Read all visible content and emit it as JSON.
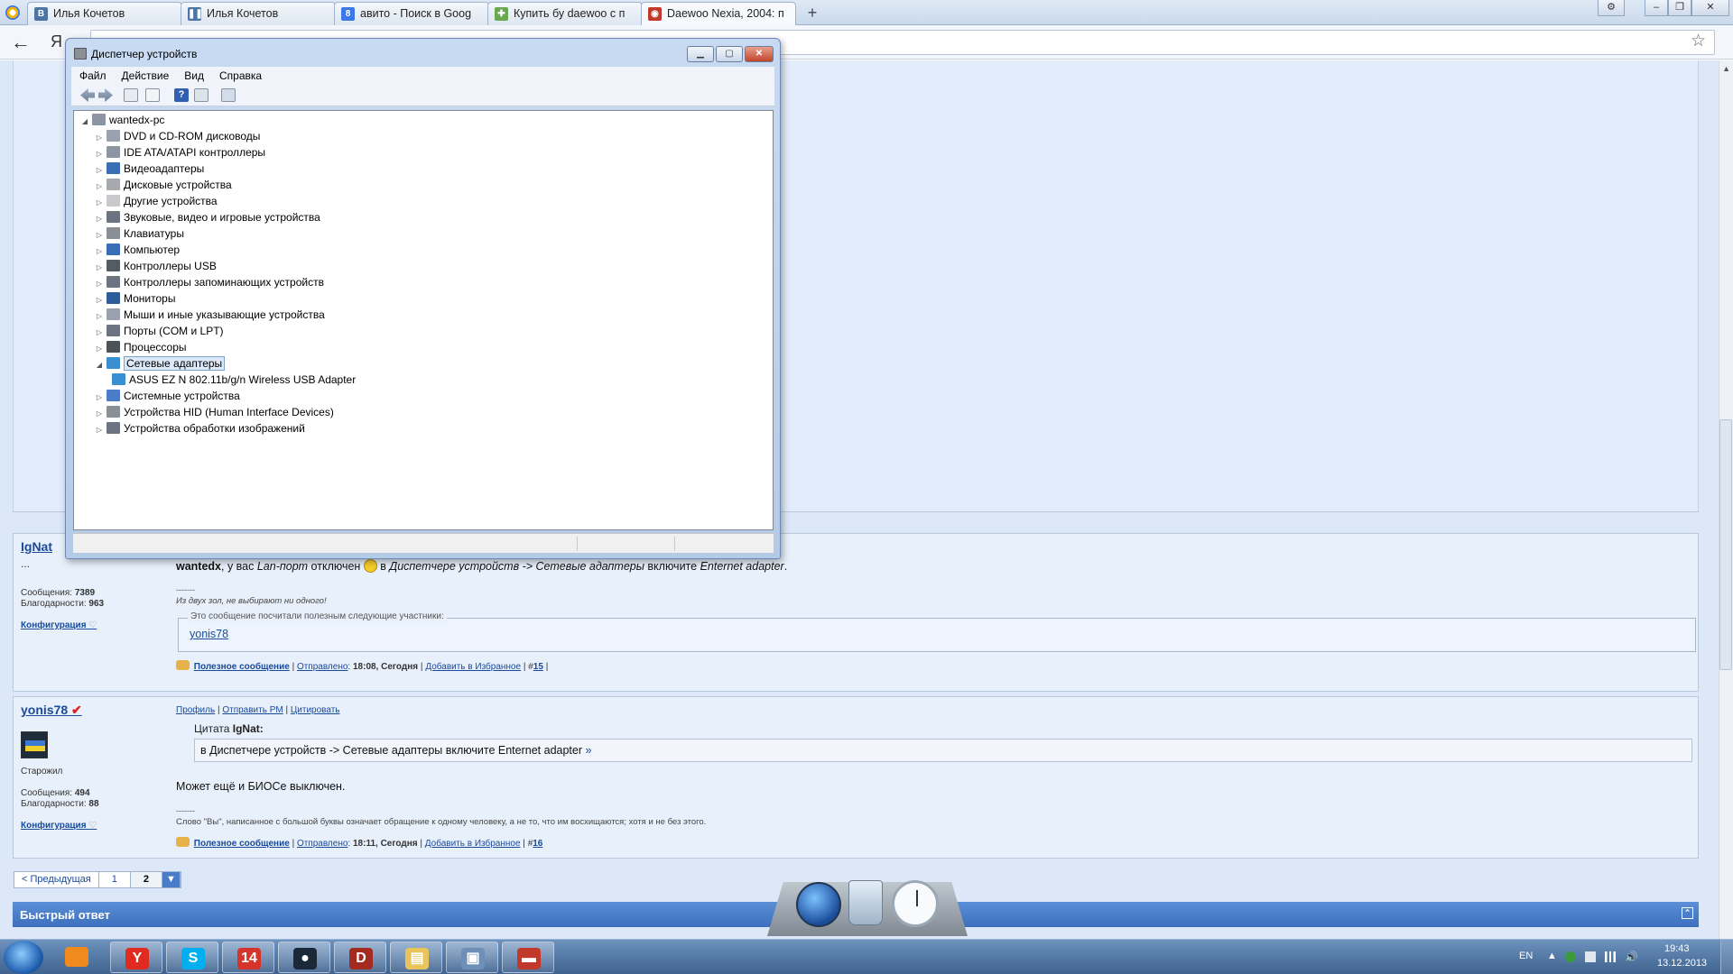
{
  "browser": {
    "tabs": [
      {
        "label": "Илья Кочетов",
        "icon": "vk-icon",
        "color": "#4c75a3"
      },
      {
        "label": "Илья Кочетов",
        "icon": "pause-icon",
        "color": "#4c75a3"
      },
      {
        "label": "авито - Поиск в Goog",
        "icon": "google-icon",
        "color": "#3b78e7"
      },
      {
        "label": "Купить бу daewoo с п",
        "icon": "avito-icon",
        "color": "#6aa84f"
      },
      {
        "label": "Daewoo Nexia, 2004: п",
        "icon": "drom-icon",
        "color": "#c0392b"
      }
    ],
    "new_tab_label": "+",
    "nav_letter": "Я"
  },
  "device_manager": {
    "title": "Диспетчер устройств",
    "menu": [
      "Файл",
      "Действие",
      "Вид",
      "Справка"
    ],
    "root": "wantedx-pc",
    "categories": [
      {
        "label": "DVD и CD-ROM дисководы",
        "icon": "dvd-drive-icon",
        "color": "#9aa3ad"
      },
      {
        "label": "IDE ATA/ATAPI контроллеры",
        "icon": "ide-controller-icon",
        "color": "#8b96a3"
      },
      {
        "label": "Видеоадаптеры",
        "icon": "display-adapter-icon",
        "color": "#3a6fb5"
      },
      {
        "label": "Дисковые устройства",
        "icon": "disk-drive-icon",
        "color": "#a6a9ad"
      },
      {
        "label": "Другие устройства",
        "icon": "other-devices-icon",
        "color": "#c7c9cc"
      },
      {
        "label": "Звуковые, видео и игровые устройства",
        "icon": "sound-icon",
        "color": "#6b7480"
      },
      {
        "label": "Клавиатуры",
        "icon": "keyboard-icon",
        "color": "#8a8f96"
      },
      {
        "label": "Компьютер",
        "icon": "computer-icon",
        "color": "#3a6fb5"
      },
      {
        "label": "Контроллеры USB",
        "icon": "usb-controller-icon",
        "color": "#555b63"
      },
      {
        "label": "Контроллеры запоминающих устройств",
        "icon": "storage-controller-icon",
        "color": "#6b7480"
      },
      {
        "label": "Мониторы",
        "icon": "monitor-icon",
        "color": "#2f5d9a"
      },
      {
        "label": "Мыши и иные указывающие устройства",
        "icon": "mouse-icon",
        "color": "#9aa3ad"
      },
      {
        "label": "Порты (COM и LPT)",
        "icon": "ports-icon",
        "color": "#6b7480"
      },
      {
        "label": "Процессоры",
        "icon": "processor-icon",
        "color": "#4d5259"
      },
      {
        "label": "Сетевые адаптеры",
        "icon": "network-adapter-icon",
        "color": "#3a8fd1",
        "expanded": true
      },
      {
        "label": "Системные устройства",
        "icon": "system-devices-icon",
        "color": "#4a7cc9"
      },
      {
        "label": "Устройства HID (Human Interface Devices)",
        "icon": "hid-icon",
        "color": "#8a8f96"
      },
      {
        "label": "Устройства обработки изображений",
        "icon": "imaging-device-icon",
        "color": "#6b7480"
      }
    ],
    "network_child": "ASUS EZ N 802.11b/g/n Wireless USB Adapter"
  },
  "forum": {
    "post1": {
      "author": "IgNat",
      "dots": "...",
      "messages_label": "Сообщения:",
      "messages": "7389",
      "thanks_label": "Благодарности:",
      "thanks": "963",
      "config": "Конфигурация",
      "text_bold": "wantedx",
      "text_a": ", у вас ",
      "text_b": "Lan-порт",
      "text_c": " отключен ",
      "text_d": " в ",
      "text_e": "Диспетчере устройств -> Сетевые адаптеры",
      "text_f": " включите ",
      "text_g": "Enternet adapter",
      "text_h": ".",
      "separator": "-------",
      "signature": "Из двух зол, не выбирают ни одного!",
      "thanks_box_title": "Это сообщение посчитали полезным следующие участники:",
      "thanks_user": "yonis78",
      "useful": "Полезное сообщение",
      "sent": "Отправлено",
      "time": "18:08, Сегодня",
      "favorite": "Добавить в Избранное",
      "num_prefix": "#",
      "num": "15"
    },
    "post2": {
      "author": "yonis78",
      "rank": "Старожил",
      "messages_label": "Сообщения:",
      "messages": "494",
      "thanks_label": "Благодарности:",
      "thanks": "88",
      "config": "Конфигурация",
      "profile": "Профиль",
      "send_pm": "Отправить PM",
      "quote_link": "Цитировать",
      "quote_head_label": "Цитата",
      "quote_author": "IgNat:",
      "quote_text": "в Диспетчере устройств -> Сетевые адаптеры включите Enternet adapter",
      "quote_arrow": "»",
      "text": "Может ещё и БИОСе выключен.",
      "separator": "-------",
      "signature": "Слово \"Вы\", написанное с большой буквы означает обращение к одному человеку, а не то, что им восхищаются; хотя и не без этого.",
      "useful": "Полезное сообщение",
      "sent": "Отправлено",
      "time": "18:11, Сегодня",
      "favorite": "Добавить в Избранное",
      "num_prefix": "#",
      "num": "16"
    },
    "pager": {
      "prev": "< Предыдущая",
      "page1": "1",
      "page2": "2",
      "dropdown": "▼"
    },
    "quick_reply": "Быстрый ответ"
  },
  "taskbar": {
    "apps": [
      {
        "name": "yandex-browser-task",
        "label": "Y",
        "color": "#e02b20"
      },
      {
        "name": "skype-task",
        "label": "S",
        "color": "#00aff0"
      },
      {
        "name": "fourteen-task",
        "label": "14",
        "color": "#d6332b"
      },
      {
        "name": "steam-task",
        "label": "●",
        "color": "#1b2838"
      },
      {
        "name": "dota-task",
        "label": "D",
        "color": "#a52a1f"
      },
      {
        "name": "explorer-task",
        "label": "▤",
        "color": "#e8c45a"
      },
      {
        "name": "device-manager-task",
        "label": "▣",
        "color": "#6e8fb8"
      },
      {
        "name": "toolbox-task",
        "label": "▬",
        "color": "#c0392b"
      }
    ],
    "lang": "EN",
    "time": "19:43",
    "date": "13.12.2013"
  }
}
